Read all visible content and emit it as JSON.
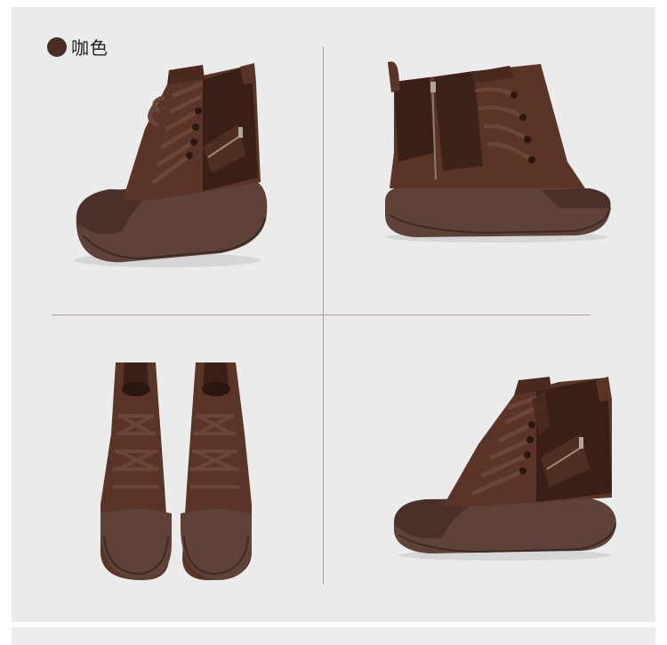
{
  "color_option": {
    "swatch_color": "#4a2d22",
    "label": "咖色"
  },
  "palette": {
    "leather": "#5a3426",
    "suede": "#3a1f16",
    "sole": "#5e4238",
    "background": "#ebebeb",
    "divider": "#b89a9a"
  }
}
